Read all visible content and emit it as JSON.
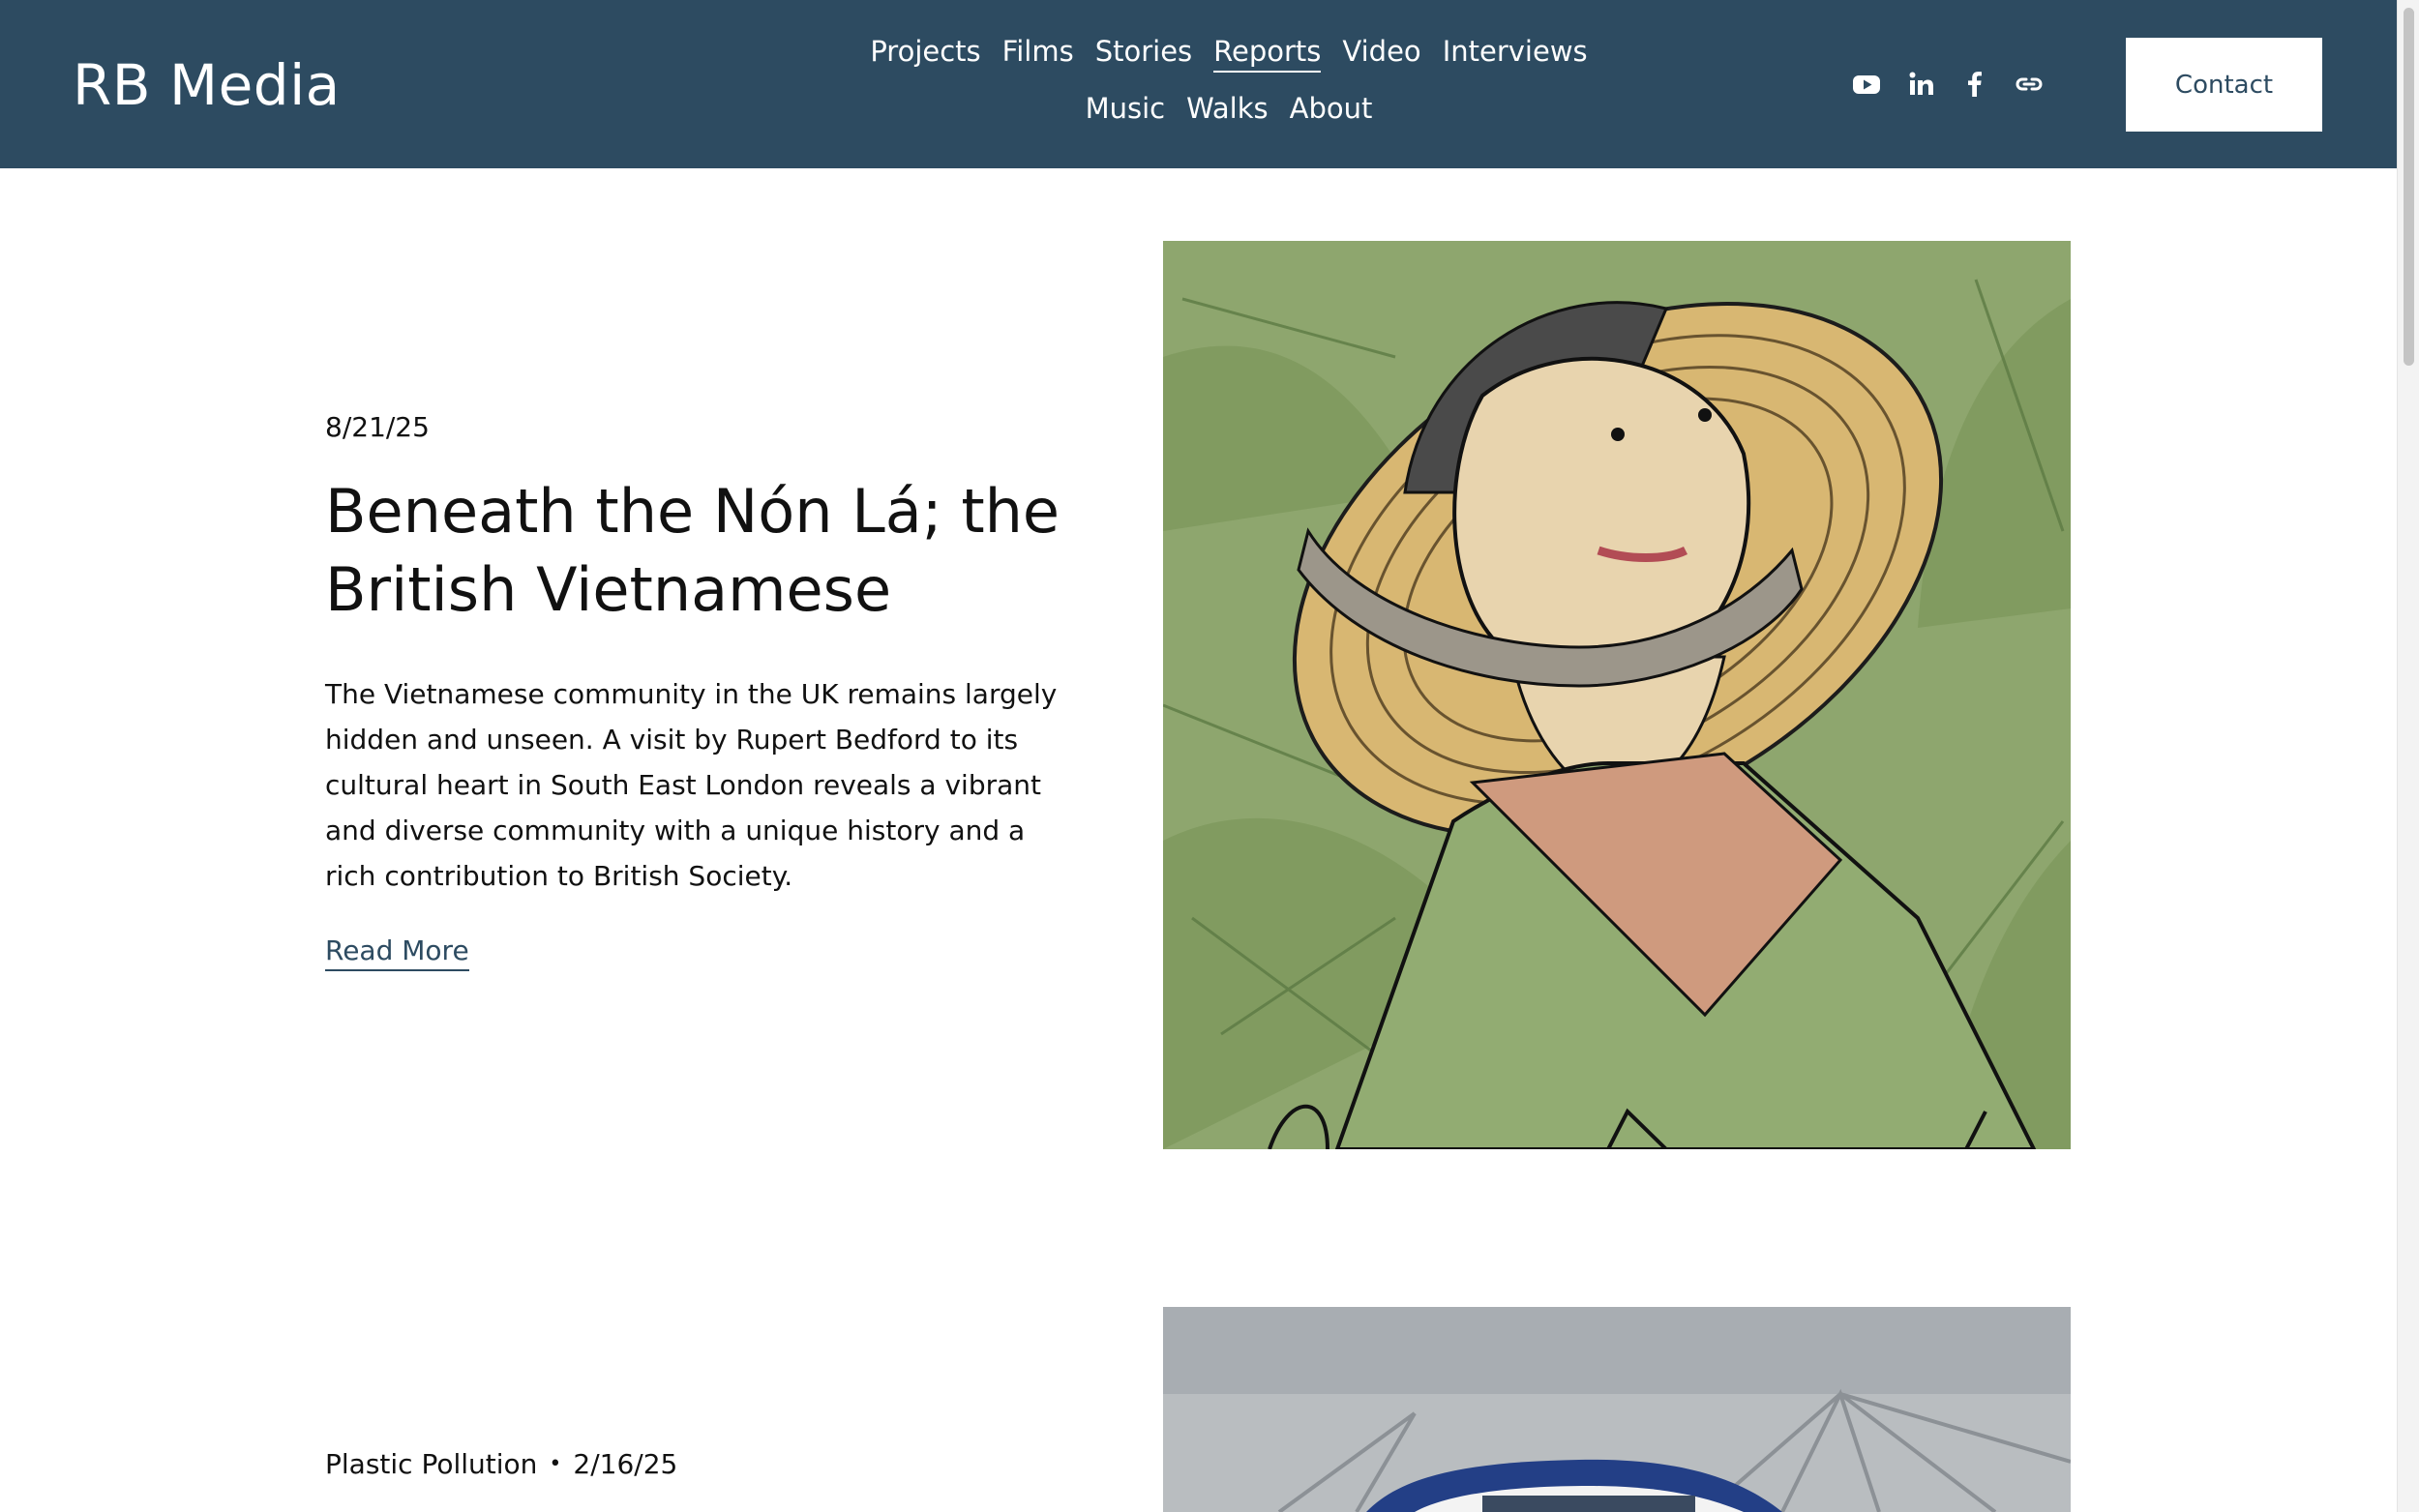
{
  "site": {
    "logo": "RB Media"
  },
  "nav": {
    "row1": [
      "Projects",
      "Films",
      "Stories",
      "Reports",
      "Video",
      "Interviews"
    ],
    "row2": [
      "Music",
      "Walks",
      "About"
    ],
    "active": "Reports"
  },
  "socials": [
    "youtube-icon",
    "linkedin-icon",
    "facebook-icon",
    "link-icon"
  ],
  "header": {
    "contact_label": "Contact",
    "background_color": "#2d4b61"
  },
  "posts": [
    {
      "date": "8/21/25",
      "title": "Beneath the Nón Lá; the British Vietnamese",
      "excerpt": "The Vietnamese community in the UK remains largely hidden and unseen. A visit by Rupert Bedford to its cultural heart in South East London reveals a vibrant and diverse community with a unique history and a rich contribution to British Society.",
      "read_more": "Read More"
    },
    {
      "category": "Plastic Pollution",
      "separator": "•",
      "date": "2/16/25"
    }
  ]
}
